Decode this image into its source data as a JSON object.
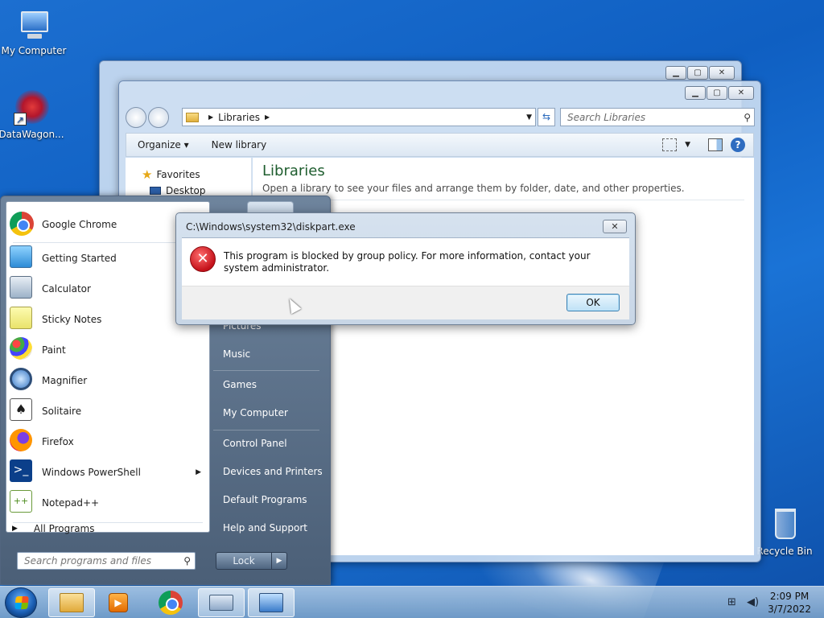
{
  "desktop": {
    "icons": [
      {
        "label": "My Computer",
        "icon": "computer-icon"
      },
      {
        "label": "DataWagon...",
        "icon": "datawagon-icon"
      },
      {
        "label": "Recycle Bin",
        "icon": "recycle-bin-icon"
      }
    ]
  },
  "explorer": {
    "address": {
      "root": "Libraries"
    },
    "search_placeholder": "Search Libraries",
    "toolbar": {
      "organize": "Organize",
      "new_library": "New library"
    },
    "nav": {
      "favorites": "Favorites",
      "desktop": "Desktop"
    },
    "content": {
      "title": "Libraries",
      "subtitle": "Open a library to see your files and arrange them by folder, date, and other properties."
    }
  },
  "start_menu": {
    "programs": [
      {
        "label": "Google Chrome",
        "icon": "chrome-icon"
      },
      {
        "label": "Getting Started",
        "icon": "getting-started-icon"
      },
      {
        "label": "Calculator",
        "icon": "calculator-icon"
      },
      {
        "label": "Sticky Notes",
        "icon": "sticky-notes-icon"
      },
      {
        "label": "Paint",
        "icon": "paint-icon"
      },
      {
        "label": "Magnifier",
        "icon": "magnifier-icon"
      },
      {
        "label": "Solitaire",
        "icon": "solitaire-icon"
      },
      {
        "label": "Firefox",
        "icon": "firefox-icon"
      },
      {
        "label": "Windows PowerShell",
        "icon": "powershell-icon"
      },
      {
        "label": "Notepad++",
        "icon": "notepadpp-icon"
      }
    ],
    "all_programs": "All Programs",
    "search_placeholder": "Search programs and files",
    "right_items": [
      "Pictures",
      "Music",
      "Games",
      "My Computer",
      "Control Panel",
      "Devices and Printers",
      "Default Programs",
      "Help and Support"
    ],
    "lock": "Lock"
  },
  "dialog": {
    "title": "C:\\Windows\\system32\\diskpart.exe",
    "message": "This program is blocked by group policy. For more information, contact your system administrator.",
    "ok": "OK",
    "close_glyph": "✕",
    "error_glyph": "✕"
  },
  "taskbar": {
    "time": "2:09 PM",
    "date": "3/7/2022"
  }
}
